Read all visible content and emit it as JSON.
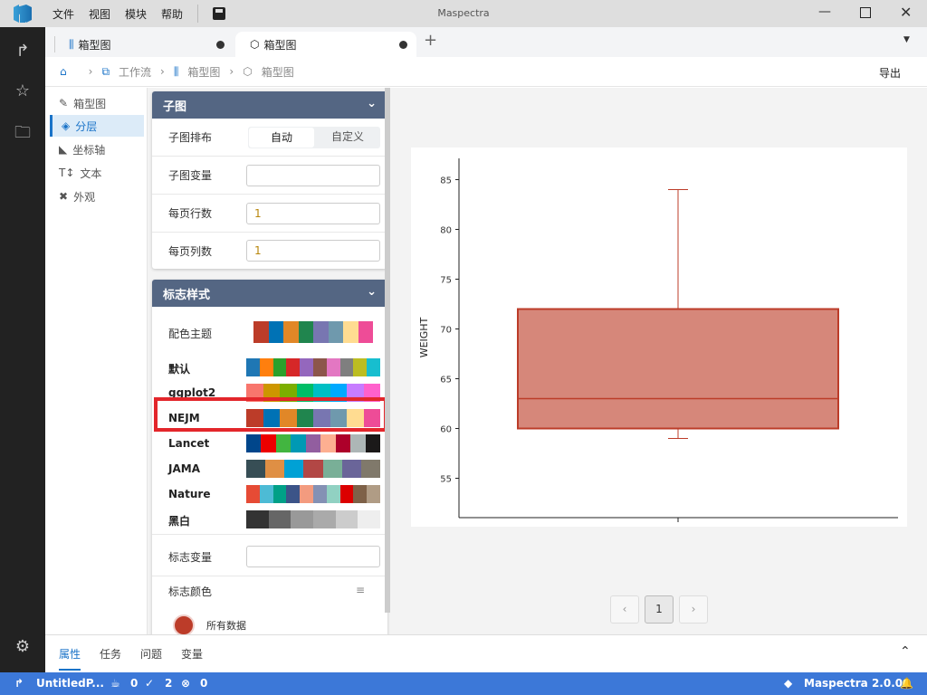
{
  "app": {
    "title": "Maspectra",
    "menu": [
      "文件",
      "视图",
      "模块",
      "帮助"
    ]
  },
  "tabs": [
    {
      "label": "箱型图",
      "icon": "boxplot-icon"
    },
    {
      "label": "箱型图",
      "icon": "cube-icon",
      "active": true
    }
  ],
  "breadcrumb": [
    "工作流",
    "箱型图",
    "箱型图"
  ],
  "export_label": "导出",
  "leftnav": [
    {
      "label": "箱型图",
      "icon": "pen-icon"
    },
    {
      "label": "分层",
      "icon": "layers-icon",
      "selected": true
    },
    {
      "label": "坐标轴",
      "icon": "axis-icon"
    },
    {
      "label": "文本",
      "icon": "text-icon"
    },
    {
      "label": "外观",
      "icon": "appearance-icon"
    }
  ],
  "subplot": {
    "title": "子图",
    "layout_label": "子图排布",
    "layout_options": [
      "自动",
      "自定义"
    ],
    "layout_selected": "自动",
    "var_label": "子图变量",
    "var_value": "",
    "rows_label": "每页行数",
    "rows_value": "1",
    "cols_label": "每页列数",
    "cols_value": "1"
  },
  "marker": {
    "title": "标志样式",
    "theme_label": "配色主题",
    "current_theme": [
      "#BC3C29",
      "#0072B5",
      "#E18727",
      "#20854E",
      "#7876B1",
      "#6F99AD",
      "#FFDC91",
      "#EE4C97"
    ],
    "palettes": [
      {
        "name": "默认",
        "colors": [
          "#1F77B4",
          "#FF7F0E",
          "#2CA02C",
          "#D62728",
          "#9467BD",
          "#8C564B",
          "#E377C2",
          "#7F7F7F",
          "#BCBD22",
          "#17BECF"
        ]
      },
      {
        "name": "ggplot2",
        "colors": [
          "#F8766D",
          "#CD9600",
          "#7CAE00",
          "#00BE67",
          "#00BFC4",
          "#00A9FF",
          "#C77CFF",
          "#FF61CC"
        ]
      },
      {
        "name": "NEJM",
        "colors": [
          "#BC3C29",
          "#0072B5",
          "#E18727",
          "#20854E",
          "#7876B1",
          "#6F99AD",
          "#FFDC91",
          "#EE4C97"
        ],
        "highlighted": true
      },
      {
        "name": "Lancet",
        "colors": [
          "#00468B",
          "#ED0000",
          "#42B540",
          "#0099B4",
          "#925E9F",
          "#FDAF91",
          "#AD002A",
          "#ADB6B6",
          "#1B1919"
        ]
      },
      {
        "name": "JAMA",
        "colors": [
          "#374E55",
          "#DF8F44",
          "#00A1D5",
          "#B24745",
          "#79AF97",
          "#6A6599",
          "#80796B"
        ]
      },
      {
        "name": "Nature",
        "colors": [
          "#E64B35",
          "#4DBBD5",
          "#00A087",
          "#3C5488",
          "#F39B7F",
          "#8491B4",
          "#91D1C2",
          "#DC0000",
          "#7E6148",
          "#B09C85"
        ]
      },
      {
        "name": "黑白",
        "colors": [
          "#333333",
          "#666666",
          "#999999",
          "#AAAAAA",
          "#CCCCCC",
          "#EEEEEE"
        ]
      }
    ],
    "var_label": "标志变量",
    "var_value": "",
    "color_label": "标志颜色",
    "legend_item": "所有数据",
    "legend_color": "#BC3C29"
  },
  "chart_data": {
    "type": "boxplot",
    "ylabel": "WEIGHT",
    "ylim": [
      53.5,
      86.5
    ],
    "yticks": [
      55,
      60,
      65,
      70,
      75,
      80,
      85
    ],
    "boxes": [
      {
        "min": 59,
        "q1": 60,
        "median": 63,
        "q3": 72,
        "max": 84
      }
    ],
    "fill": "#D6877A",
    "stroke": "#BC3C29"
  },
  "pager": {
    "current": "1"
  },
  "bottom_tabs": [
    "属性",
    "任务",
    "问题",
    "变量"
  ],
  "status": {
    "project": "UntitledP...",
    "cups": "0",
    "ok": "2",
    "errors": "0",
    "version": "Maspectra 2.0.0"
  }
}
